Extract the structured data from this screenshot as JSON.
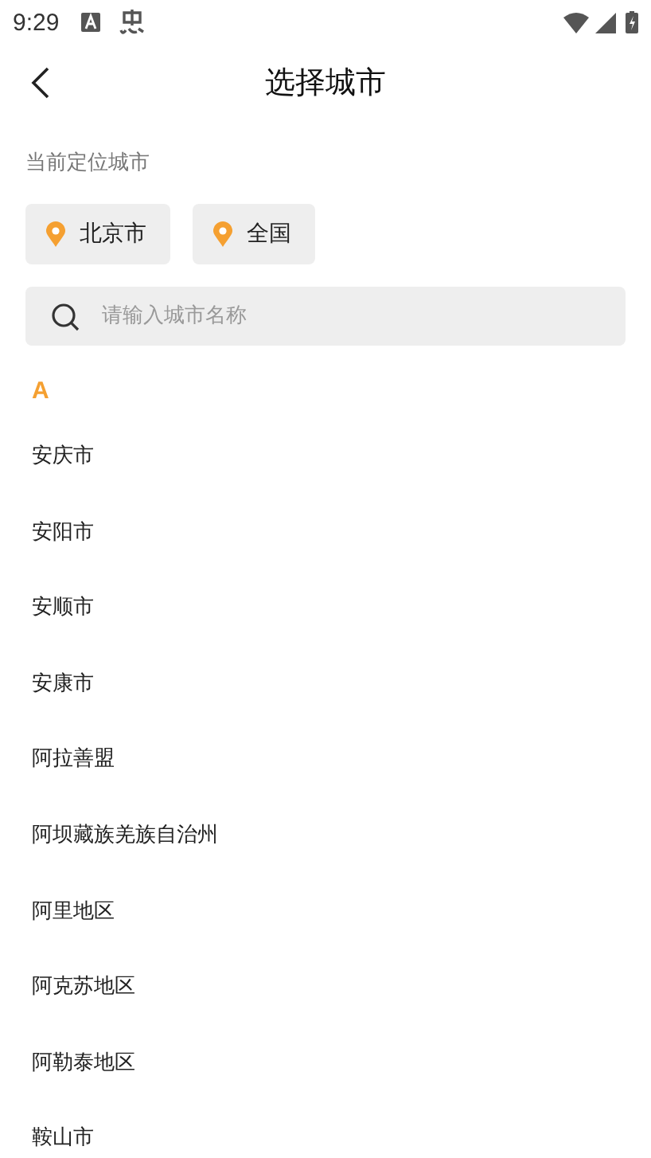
{
  "status_bar": {
    "time": "9:29"
  },
  "header": {
    "title": "选择城市"
  },
  "location": {
    "label": "当前定位城市",
    "chips": [
      {
        "label": "北京市"
      },
      {
        "label": "全国"
      }
    ]
  },
  "search": {
    "placeholder": "请输入城市名称"
  },
  "sections": [
    {
      "letter": "A",
      "cities": [
        "安庆市",
        "安阳市",
        "安顺市",
        "安康市",
        "阿拉善盟",
        "阿坝藏族羌族自治州",
        "阿里地区",
        "阿克苏地区",
        "阿勒泰地区",
        "鞍山市"
      ]
    }
  ]
}
